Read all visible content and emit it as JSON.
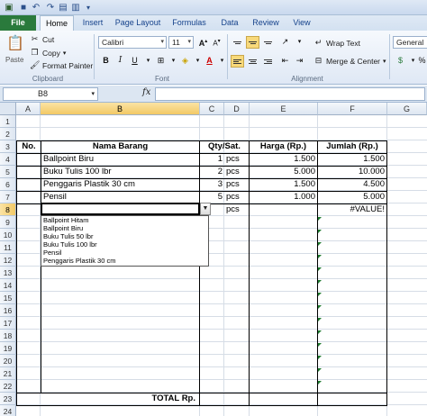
{
  "window": {
    "tabs": [
      "File",
      "Home",
      "Insert",
      "Page Layout",
      "Formulas",
      "Data",
      "Review",
      "View"
    ],
    "active_tab": "Home"
  },
  "ribbon": {
    "clipboard": {
      "paste": "Paste",
      "cut": "Cut",
      "copy": "Copy",
      "format_painter": "Format Painter",
      "label": "Clipboard"
    },
    "font": {
      "name": "Calibri",
      "size": "11",
      "bold": "B",
      "italic": "I",
      "underline": "U",
      "grow": "A",
      "shrink": "A",
      "label": "Font"
    },
    "alignment": {
      "wrap_text": "Wrap Text",
      "merge_center": "Merge & Center",
      "label": "Alignment"
    },
    "number": {
      "format": "General"
    }
  },
  "formula_bar": {
    "name_box": "B8",
    "fx": "fx",
    "value": ""
  },
  "columns": [
    "A",
    "B",
    "C",
    "D",
    "E",
    "F",
    "G"
  ],
  "selected_column": "B",
  "rows": [
    "1",
    "2",
    "3",
    "4",
    "5",
    "6",
    "7",
    "8",
    "9",
    "10",
    "11",
    "12",
    "13",
    "14",
    "15",
    "16",
    "17",
    "18",
    "19",
    "20",
    "21",
    "22",
    "23",
    "24"
  ],
  "selected_row": "8",
  "table": {
    "headers": {
      "no": "No.",
      "nama": "Nama Barang",
      "qty": "Qty/Sat.",
      "harga": "Harga (Rp.)",
      "jumlah": "Jumlah (Rp.)"
    },
    "items": [
      {
        "nama": "Ballpoint Biru",
        "qty": "1",
        "sat": "pcs",
        "harga": "1.500",
        "jumlah": "1.500"
      },
      {
        "nama": "Buku Tulis 100 lbr",
        "qty": "2",
        "sat": "pcs",
        "harga": "5.000",
        "jumlah": "10.000"
      },
      {
        "nama": "Penggaris Plastik 30 cm",
        "qty": "3",
        "sat": "pcs",
        "harga": "1.500",
        "jumlah": "4.500"
      },
      {
        "nama": "Pensil",
        "qty": "5",
        "sat": "pcs",
        "harga": "1.000",
        "jumlah": "5.000"
      }
    ],
    "row8": {
      "sat": "pcs",
      "jumlah": "#VALUE!"
    },
    "total_label": "TOTAL Rp."
  },
  "dropdown": {
    "options": [
      "Ballpoint Hitam",
      "Ballpoint Biru",
      "Buku Tulis 50 lbr",
      "Buku Tulis 100 lbr",
      "Pensil",
      "Penggaris Plastik 30 cm"
    ]
  }
}
